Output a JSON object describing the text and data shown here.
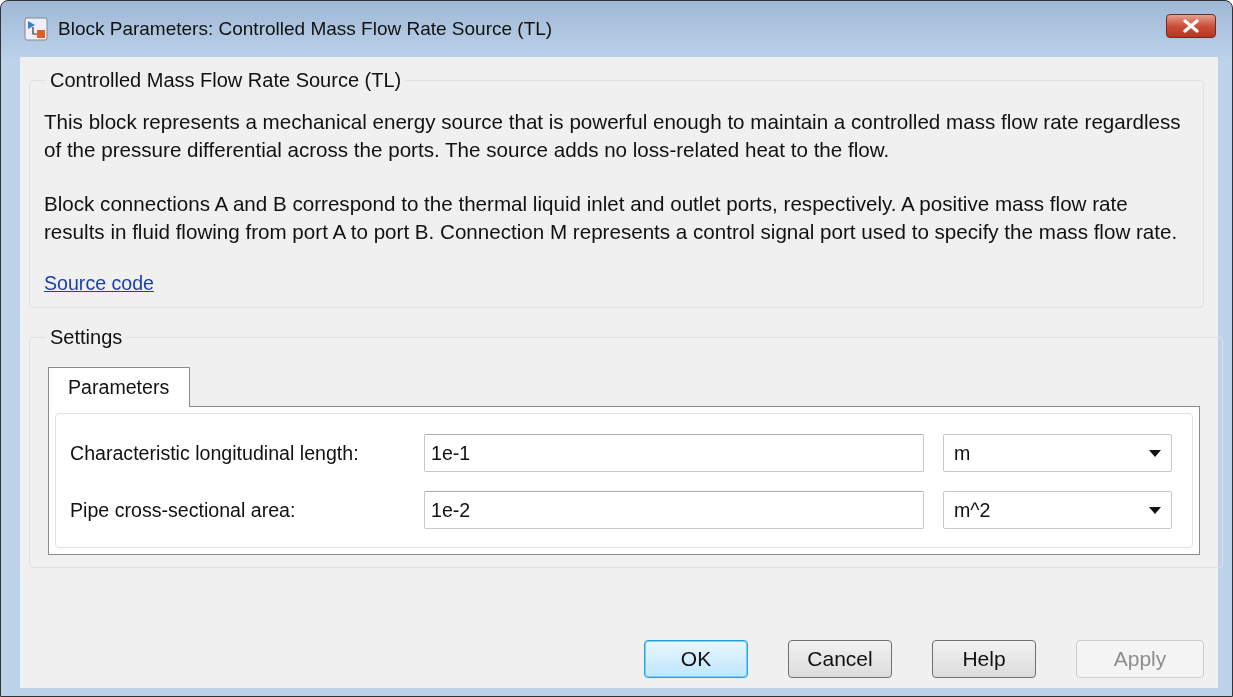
{
  "window": {
    "title": "Block Parameters: Controlled Mass Flow Rate Source (TL)"
  },
  "description": {
    "title": "Controlled Mass Flow Rate Source (TL)",
    "paragraphs": [
      "This block represents a mechanical energy source that is powerful enough to maintain a controlled mass flow rate regardless of the pressure differential across the ports. The source adds no loss-related heat to the flow.",
      "Block connections A and B correspond to the thermal liquid inlet and outlet ports, respectively. A positive mass flow rate results in fluid flowing from port A to port B. Connection M represents a control signal port used to specify the mass flow rate."
    ],
    "link": "Source code"
  },
  "settings": {
    "title": "Settings",
    "tabs": [
      {
        "label": "Parameters",
        "selected": true
      }
    ],
    "parameters": [
      {
        "label": "Characteristic longitudinal length:",
        "value": "1e-1",
        "unit": "m"
      },
      {
        "label": "Pipe cross-sectional area:",
        "value": "1e-2",
        "unit": "m^2"
      }
    ]
  },
  "buttons": [
    {
      "label": "OK",
      "default": true,
      "disabled": false
    },
    {
      "label": "Cancel",
      "default": false,
      "disabled": false
    },
    {
      "label": "Help",
      "default": false,
      "disabled": false
    },
    {
      "label": "Apply",
      "default": false,
      "disabled": true
    }
  ]
}
